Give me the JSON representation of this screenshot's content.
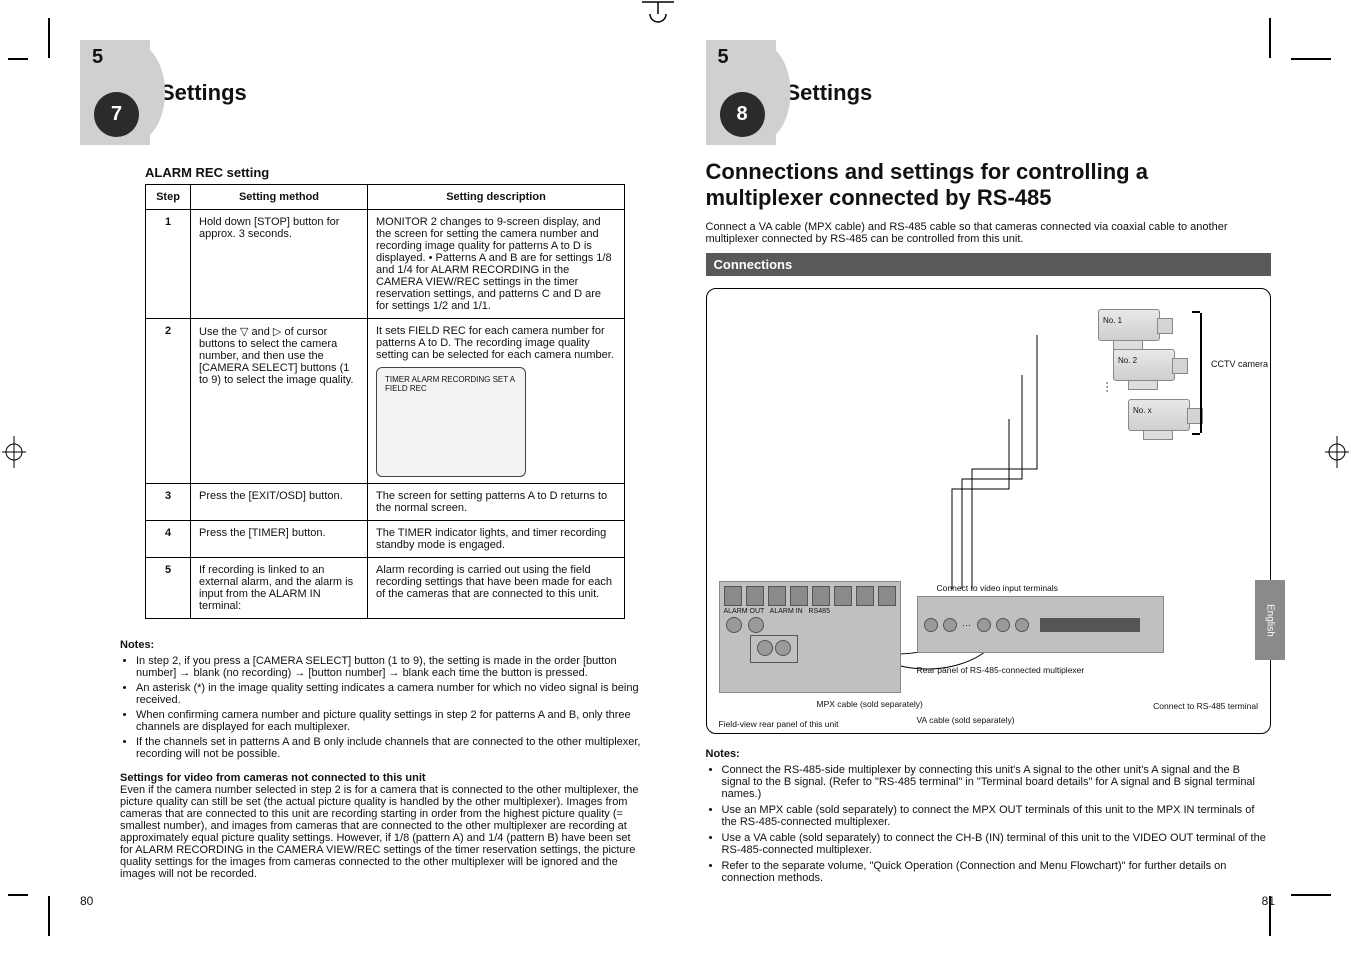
{
  "left": {
    "badge_step": "5",
    "badge_num": "7",
    "section_title": "Settings",
    "table_title": "ALARM REC setting",
    "columns": [
      "Step",
      "Setting method",
      "Setting description"
    ],
    "rows": [
      {
        "num": "1",
        "method": "Hold down [STOP] button for approx. 3 seconds.",
        "desc": "MONITOR 2 changes to 9-screen display, and the screen for setting the camera number and recording image quality for patterns A to D is displayed.\n\n• Patterns A and B are for settings 1/8 and 1/4 for ALARM RECORDING in the CAMERA VIEW/REC settings in the timer reservation settings, and patterns C and D are for settings 1/2 and 1/1."
      },
      {
        "num": "2",
        "method_prefix": "Use the ",
        "method_mid": " and ",
        "method_suffix": " of cursor buttons to select the camera number, and then use the [CAMERA SELECT] buttons (1 to 9) to select the image quality.",
        "desc": "It sets FIELD REC for each camera number for patterns A to D. The recording image quality setting can be selected for each camera number.",
        "monitor_line1": "TIMER ALARM RECORDING SET A",
        "monitor_line2": "FIELD REC"
      },
      {
        "num": "3",
        "method": "Press the [EXIT/OSD] button.",
        "desc": "The screen for setting patterns A to D returns to the normal screen."
      },
      {
        "num": "4",
        "method": "Press the [TIMER] button.",
        "desc": "The TIMER indicator lights, and timer recording standby mode is engaged."
      },
      {
        "num": "5",
        "method": "If recording is linked to an external alarm, and the alarm is input from the ALARM IN terminal:",
        "desc": "Alarm recording is carried out using the field recording settings that have been made for each of the cameras that are connected to this unit."
      }
    ],
    "notes_title": "Notes:",
    "notes": [
      "In step 2, if you press a [CAMERA SELECT] button (1 to 9), the setting is made in the order [button number] → blank (no recording) → [button number] → blank each time the button is pressed.",
      "An asterisk (*) in the image quality setting indicates a camera number for which no video signal is being received.",
      "When confirming camera number and picture quality settings in step 2 for patterns A and B, only three channels are displayed for each multiplexer.",
      "If the channels set in patterns A and B only include channels that are connected to the other multiplexer, recording will not be possible."
    ],
    "settings_note_title": "Settings for video from cameras not connected to this unit",
    "settings_note_body": "Even if the camera number selected in step 2 is for a camera that is connected to the other multiplexer, the picture quality can still be set (the actual picture quality is handled by the other multiplexer). Images from cameras that are connected to this unit are recording starting in order from the highest picture quality (= smallest number), and images from cameras that are connected to the other multiplexer are recording at approximately equal picture quality settings.\nHowever, if 1/8 (pattern A) and 1/4 (pattern B) have been set for ALARM RECORDING in the CAMERA VIEW/REC settings of the timer reservation settings, the picture quality settings for the images from cameras connected to the other multiplexer will be ignored and the images will not be recorded.",
    "page": "80"
  },
  "right": {
    "badge_step": "5",
    "badge_num": "8",
    "section_title": "Settings",
    "title": "Connections and settings for controlling a multiplexer connected by RS-485",
    "intro": "Connect a VA cable (MPX cable) and RS-485 cable so that cameras connected via coaxial cable to another multiplexer connected by RS-485 can be controlled from this unit.",
    "barhead": "Connections",
    "fig": {
      "cam1": "No. 1",
      "cam2": "No. 2",
      "camN": "No. x",
      "cam_dots": "···",
      "brace_label": "CCTV camera",
      "cap_fv": "Field-view rear panel of this unit",
      "cap_rear": "Rear panel of RS-485-connected multiplexer",
      "cap_video_in": "Connect to video input terminals",
      "cap_rs485": "Connect to RS-485 terminal",
      "cap_mpx": "MPX cable (sold separately)",
      "cap_va": "VA cable (sold separately)"
    },
    "notes_title": "Notes:",
    "notes": [
      "Connect the RS-485-side multiplexer by connecting this unit's A signal to the other unit's A signal and the B signal to the B signal. (Refer to \"RS-485 terminal\" in \"Terminal board details\" for A signal and B signal terminal names.)",
      "Use an MPX cable (sold separately) to connect the MPX OUT terminals of this unit to the MPX IN terminals of the RS-485-connected multiplexer.",
      "Use a VA cable (sold separately) to connect the CH-B (IN) terminal of this unit to the VIDEO OUT terminal of the RS-485-connected multiplexer.",
      "Refer to the separate volume, \"Quick Operation (Connection and Menu Flowchart)\" for further details on connection methods."
    ],
    "side_tab": "English",
    "page": "81"
  }
}
